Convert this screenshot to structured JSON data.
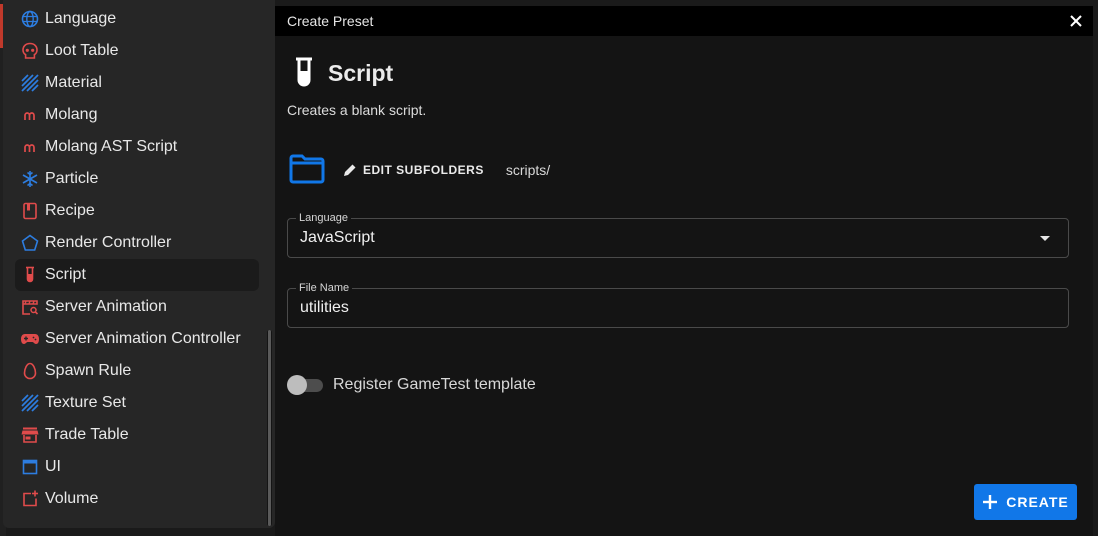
{
  "colors": {
    "accent": "#1177e8",
    "icon_red": "#e04b4b",
    "icon_blue": "#2d7de0",
    "background": "#141414",
    "sidebar": "#262626"
  },
  "sidebar": {
    "items": [
      {
        "label": "Language",
        "icon": "globe-icon"
      },
      {
        "label": "Loot Table",
        "icon": "skull-icon"
      },
      {
        "label": "Material",
        "icon": "hatch-icon"
      },
      {
        "label": "Molang",
        "icon": "m-icon"
      },
      {
        "label": "Molang AST Script",
        "icon": "m-icon"
      },
      {
        "label": "Particle",
        "icon": "snowflake-icon"
      },
      {
        "label": "Recipe",
        "icon": "book-icon"
      },
      {
        "label": "Render Controller",
        "icon": "pentagon-icon"
      },
      {
        "label": "Script",
        "icon": "test-tube-icon"
      },
      {
        "label": "Server Animation",
        "icon": "movie-search-icon"
      },
      {
        "label": "Server Animation Controller",
        "icon": "gamepad-icon"
      },
      {
        "label": "Spawn Rule",
        "icon": "egg-icon"
      },
      {
        "label": "Texture Set",
        "icon": "hatch-icon"
      },
      {
        "label": "Trade Table",
        "icon": "store-icon"
      },
      {
        "label": "UI",
        "icon": "window-icon"
      },
      {
        "label": "Volume",
        "icon": "square-plus-icon"
      }
    ],
    "active_index": 8
  },
  "dialog": {
    "title": "Create Preset",
    "preset_name": "Script",
    "preset_icon": "test-tube-icon",
    "description": "Creates a blank script.",
    "edit_subfolders_label": "EDIT SUBFOLDERS",
    "folder_path": "scripts/",
    "language_field": {
      "label": "Language",
      "value": "JavaScript"
    },
    "file_name_field": {
      "label": "File Name",
      "value": "utilities"
    },
    "toggle": {
      "label": "Register GameTest template",
      "checked": false
    },
    "create_label": "CREATE"
  }
}
